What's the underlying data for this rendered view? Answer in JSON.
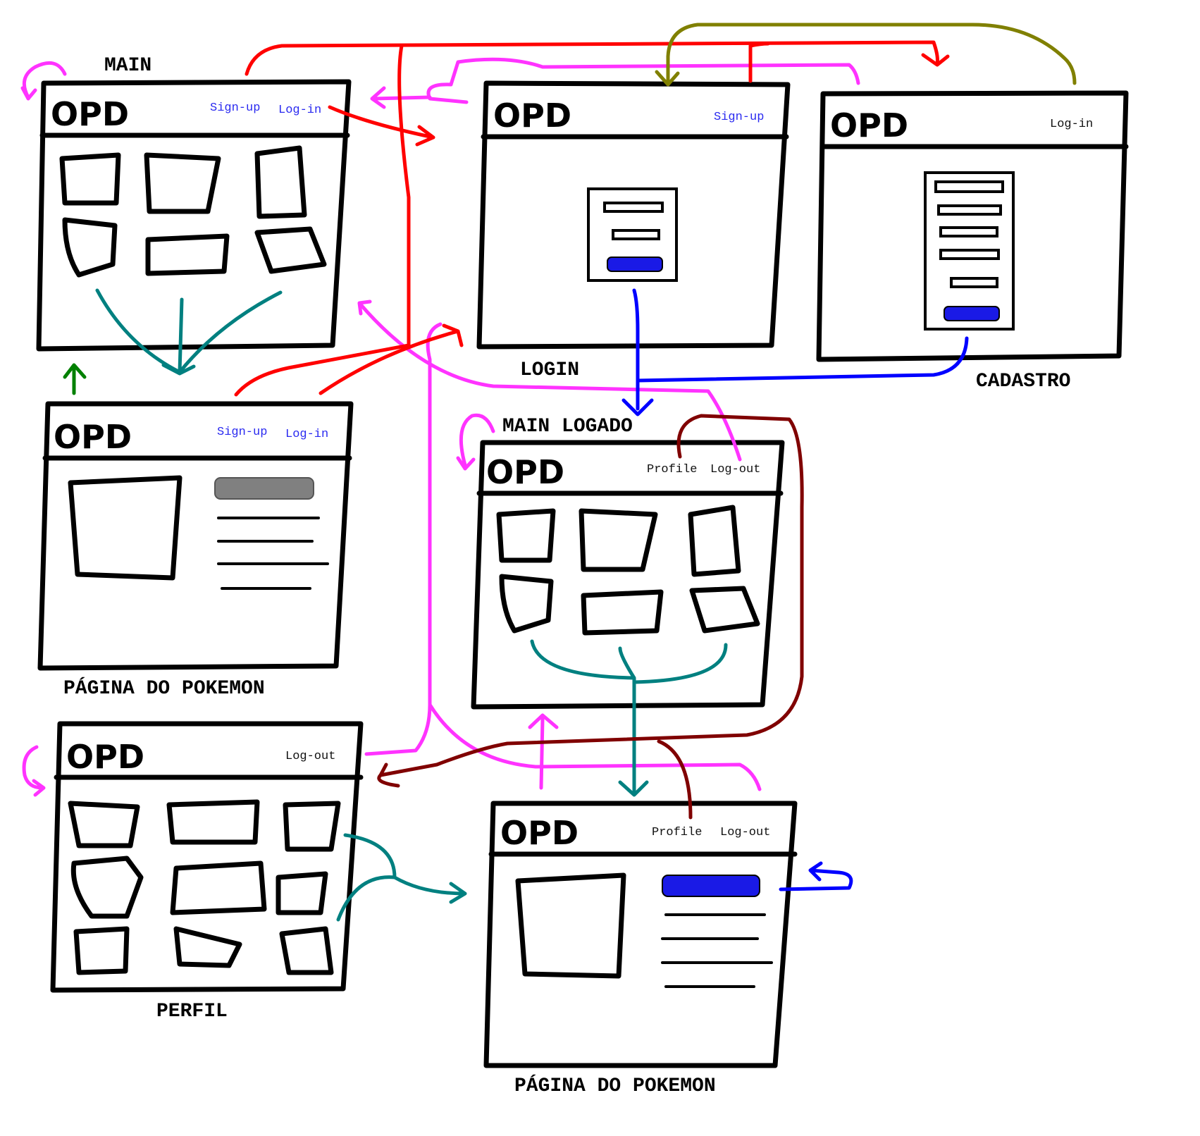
{
  "colors": {
    "magenta": "#ff33ff",
    "red": "#ff0000",
    "olive": "#808000",
    "blue": "#0000ff",
    "teal": "#008080",
    "green": "#008000",
    "maroon": "#800000",
    "button_blue": "#1a1ae6",
    "button_gray": "#808080"
  },
  "screens": {
    "main": {
      "title": "MAIN",
      "logo": "OPD",
      "nav": [
        "Sign-up",
        "Log-in"
      ]
    },
    "login": {
      "title": "LOGIN",
      "logo": "OPD",
      "nav": [
        "Sign-up"
      ]
    },
    "cadastro": {
      "title": "CADASTRO",
      "logo": "OPD",
      "nav": [
        "Log-in"
      ]
    },
    "pokemon_page": {
      "title": "PÁGINA DO POKEMON",
      "logo": "OPD",
      "nav": [
        "Sign-up",
        "Log-in"
      ]
    },
    "main_logado": {
      "title": "MAIN LOGADO",
      "logo": "OPD",
      "nav": [
        "Profile",
        "Log-out"
      ]
    },
    "perfil": {
      "title": "PERFIL",
      "logo": "OPD",
      "nav": [
        "Log-out"
      ]
    },
    "pokemon_page_logado": {
      "title": "PÁGINA DO POKEMON",
      "logo": "OPD",
      "nav": [
        "Profile",
        "Log-out"
      ]
    }
  },
  "icons": {
    "logo": "opd-logo-icon"
  }
}
